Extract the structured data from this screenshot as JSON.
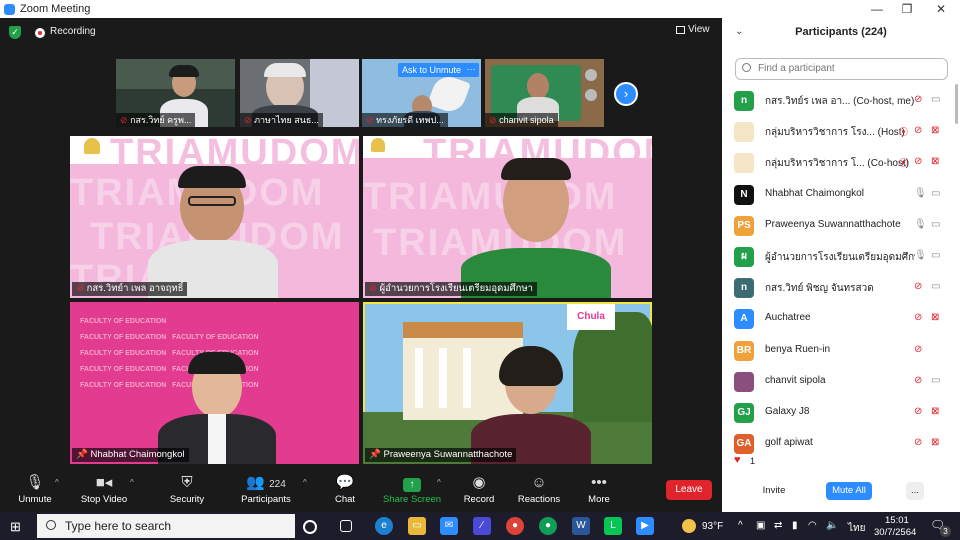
{
  "window": {
    "title": "Zoom Meeting",
    "minimize": "—",
    "maximize": "❐",
    "close": "✕"
  },
  "meeting": {
    "recording_label": "Recording",
    "view_label": "View",
    "thumbnails": [
      {
        "name": "กสร.วิทย์ ครูพ..."
      },
      {
        "name": "ภาษาไทย สนธ..."
      },
      {
        "name": "ทรงภัยรดี เทพป...",
        "overlay": "Ask to Unmute",
        "more": "···"
      },
      {
        "name": "chanvit sipola"
      }
    ],
    "next_arrow": "›",
    "tiles": [
      {
        "name": "กสร.วิทย์า เพล  อาจฤทธิ์",
        "watermark": "TRIAMUDOM"
      },
      {
        "name": "ผู้อำนวยการโรงเรียนเตรียมอุดมศึกษา"
      },
      {
        "name": "Nhabhat Chaimongkol",
        "logo_text": "FACULTY OF EDUCATION"
      },
      {
        "name": "Praweenya Suwannatthachote",
        "badge": "Chula"
      }
    ]
  },
  "toolbar": {
    "unmute": "Unmute",
    "stop_video": "Stop Video",
    "security": "Security",
    "participants": "Participants",
    "participants_count": "224",
    "chat": "Chat",
    "share_screen": "Share Screen",
    "record": "Record",
    "reactions": "Reactions",
    "more": "More",
    "leave": "Leave"
  },
  "panel": {
    "title": "Participants (224)",
    "search_placeholder": "Find a participant",
    "participants": [
      {
        "avatar": "n",
        "color": "#23a14a",
        "name": "กสร.วิทย์ร เพล อา...  (Co-host, me)",
        "mic": "off",
        "cam": "on"
      },
      {
        "avatar": "",
        "color": "#f5e6c8",
        "name": "กลุ่มบริหารวิชาการ โรง...  (Host)",
        "mic": "off",
        "cam": "off",
        "rec": true
      },
      {
        "avatar": "",
        "color": "#f5e6c8",
        "name": "กลุ่มบริหารวิชาการ โ...  (Co-host)",
        "mic": "off",
        "cam": "off",
        "rec": true
      },
      {
        "avatar": "N",
        "color": "#111111",
        "name": "Nhabhat Chaimongkol",
        "mic": "on",
        "cam": "on"
      },
      {
        "avatar": "PS",
        "color": "#f0a23a",
        "name": "Praweenya Suwannatthachote",
        "mic": "on",
        "cam": "on"
      },
      {
        "avatar": "ผ",
        "color": "#23a14a",
        "name": "ผู้อำนวยการโรงเรียนเตรียมอุดมศึกษา",
        "mic": "on",
        "cam": "on"
      },
      {
        "avatar": "n",
        "color": "#3d6b73",
        "name": "กสร.วิทย์ พิชญ จันทรสวด",
        "mic": "off",
        "cam": "on"
      },
      {
        "avatar": "A",
        "color": "#2D8CFF",
        "name": "Auchatree",
        "mic": "off",
        "cam": "off"
      },
      {
        "avatar": "BR",
        "color": "#f0a23a",
        "name": "benya Ruen-in",
        "mic": "off",
        "cam": "none"
      },
      {
        "avatar": "",
        "color": "#8a4f7d",
        "name": "chanvit sipola",
        "mic": "off",
        "cam": "on"
      },
      {
        "avatar": "GJ",
        "color": "#23a14a",
        "name": "Galaxy J8",
        "mic": "off",
        "cam": "off"
      },
      {
        "avatar": "GA",
        "color": "#e0602b",
        "name": "golf apiwat",
        "mic": "off",
        "cam": "off"
      }
    ],
    "reaction_count": "1",
    "invite": "Invite",
    "mute_all": "Mute All",
    "more": "..."
  },
  "taskbar": {
    "search_placeholder": "Type here to search",
    "weather": "93°F",
    "language": "ไทย",
    "time": "15:01",
    "date": "30/7/2564",
    "notifications": "3"
  }
}
